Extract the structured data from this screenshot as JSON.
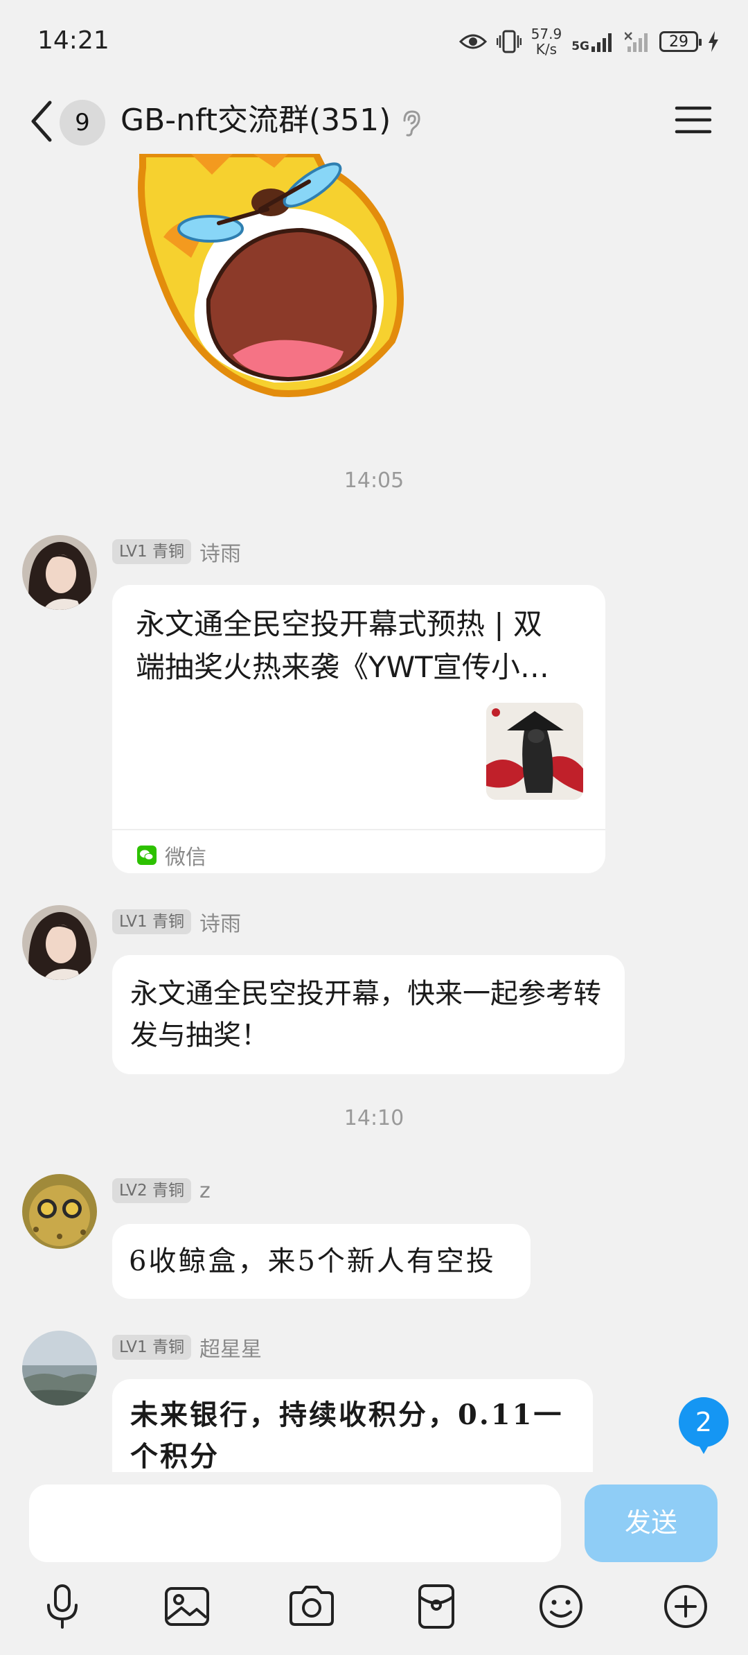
{
  "status_bar": {
    "time": "14:21",
    "net_speed_value": "57.9",
    "net_speed_unit": "K/s",
    "network_type": "5G",
    "battery": "29"
  },
  "header": {
    "unread_count": "9",
    "title": "GB-nft交流群(351)"
  },
  "messages": [
    {
      "type": "time",
      "text": "14:05"
    },
    {
      "type": "card",
      "level": "LV1 青铜",
      "sender": "诗雨",
      "title": "永文通全民空投开幕式预热 | 双端抽奖火热来袭《YWT宣传小…",
      "source": "微信"
    },
    {
      "type": "text",
      "level": "LV1 青铜",
      "sender": "诗雨",
      "text": "永文通全民空投开幕，快来一起参考转发与抽奖！"
    },
    {
      "type": "time",
      "text": "14:10"
    },
    {
      "type": "text",
      "level": "LV2 青铜",
      "sender": "z",
      "text": "6收鲸盒，来5个新人有空投"
    },
    {
      "type": "text",
      "level": "LV1 青铜",
      "sender": "超星星",
      "text": "未来银行，持续收积分，0.11一个积分"
    }
  ],
  "floating_badge": "2",
  "composer": {
    "send_label": "发送"
  },
  "toolbar_icons": [
    "mic-icon",
    "image-icon",
    "camera-icon",
    "red-packet-icon",
    "emoji-icon",
    "plus-icon"
  ],
  "colors": {
    "background": "#f1f1f1",
    "accent": "#1596f3",
    "send_disabled": "#8fcdf6"
  }
}
